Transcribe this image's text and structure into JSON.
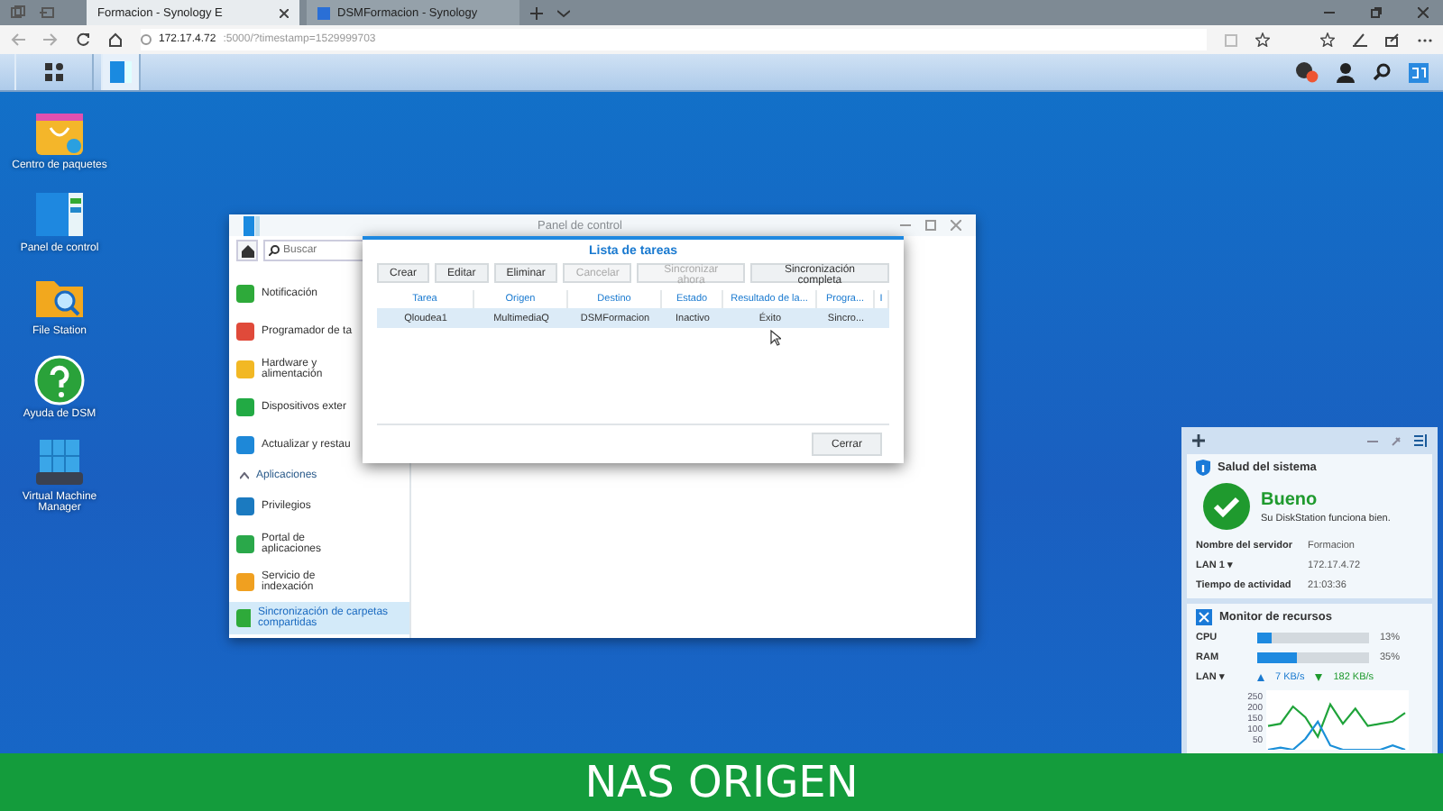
{
  "browser": {
    "tabs": [
      {
        "title": "Formacion - Synology E",
        "selected": true
      },
      {
        "title": "DSMFormacion - Synology",
        "selected": false
      }
    ],
    "url": {
      "host": "172.17.4.72",
      "rest": ":5000/?timestamp=1529999703"
    }
  },
  "desktop_icons": [
    {
      "label": "Centro de paquetes"
    },
    {
      "label": "Panel de control"
    },
    {
      "label": "File Station"
    },
    {
      "label": "Ayuda de DSM"
    },
    {
      "label": "Virtual Machine Manager"
    }
  ],
  "control_panel": {
    "title": "Panel de control",
    "search": {
      "placeholder": "Buscar"
    },
    "items": [
      {
        "kind": "item",
        "label": "Notificación",
        "selected": false
      },
      {
        "kind": "item",
        "label": "Programador de ta",
        "selected": false
      },
      {
        "kind": "item",
        "label": "Hardware y alimentación",
        "selected": false
      },
      {
        "kind": "item",
        "label": "Dispositivos exter",
        "selected": false
      },
      {
        "kind": "item",
        "label": "Actualizar y restau",
        "selected": false
      },
      {
        "kind": "section",
        "label": "Aplicaciones",
        "expanded": true
      },
      {
        "kind": "item",
        "label": "Privilegios",
        "selected": false
      },
      {
        "kind": "item",
        "label": "Portal de aplicaciones",
        "selected": false
      },
      {
        "kind": "item",
        "label": "Servicio de indexación",
        "selected": false
      },
      {
        "kind": "item",
        "label": "Sincronización de carpetas compartidas",
        "selected": true
      }
    ]
  },
  "dialog": {
    "title": "Lista de tareas",
    "buttons": [
      {
        "label": "Crear",
        "disabled": false
      },
      {
        "label": "Editar",
        "disabled": false
      },
      {
        "label": "Eliminar",
        "disabled": false
      },
      {
        "label": "Cancelar",
        "disabled": true
      },
      {
        "label": "Sincronizar ahora",
        "disabled": true
      },
      {
        "label": "Sincronización completa",
        "disabled": false
      }
    ],
    "columns": [
      "Tarea",
      "Origen",
      "Destino",
      "Estado",
      "Resultado de la...",
      "Progra...",
      "I"
    ],
    "rows": [
      {
        "cells": [
          "Qloudea1",
          "MultimediaQ",
          "DSMFormacion",
          "Inactivo",
          "Éxito",
          "Sincro..."
        ],
        "selected": true
      }
    ],
    "close_button": "Cerrar"
  },
  "widgets": {
    "system_health": {
      "title": "Salud del sistema",
      "status": "Bueno",
      "message": "Su DiskStation funciona bien.",
      "info": [
        {
          "label": "Nombre del servidor",
          "value": "Formacion"
        },
        {
          "label": "LAN 1 ▾",
          "value": "172.17.4.72"
        },
        {
          "label": "Tiempo de actividad",
          "value": "21:03:36"
        }
      ]
    },
    "resource_monitor": {
      "title": "Monitor de recursos",
      "meters": [
        {
          "label": "CPU",
          "level": 0.13,
          "reading": "13%"
        },
        {
          "label": "RAM",
          "level": 0.35,
          "reading": "35%"
        }
      ],
      "lan": {
        "label": "LAN ▾",
        "upload": "7 KB/s",
        "download": "182 KB/s"
      },
      "chart_data": {
        "type": "line",
        "yticks": [
          50,
          100,
          150,
          200,
          250
        ],
        "ylim": [
          0,
          250
        ],
        "series": [
          {
            "color": "#1fa33a",
            "values": [
              110,
              120,
              200,
              150,
              60,
              210,
              120,
              190,
              110,
              120,
              130,
              170
            ]
          },
          {
            "color": "#1a8fd8",
            "values": [
              0,
              10,
              0,
              50,
              130,
              20,
              0,
              0,
              0,
              0,
              20,
              0
            ]
          }
        ]
      }
    }
  },
  "caption": "NAS ORIGEN"
}
